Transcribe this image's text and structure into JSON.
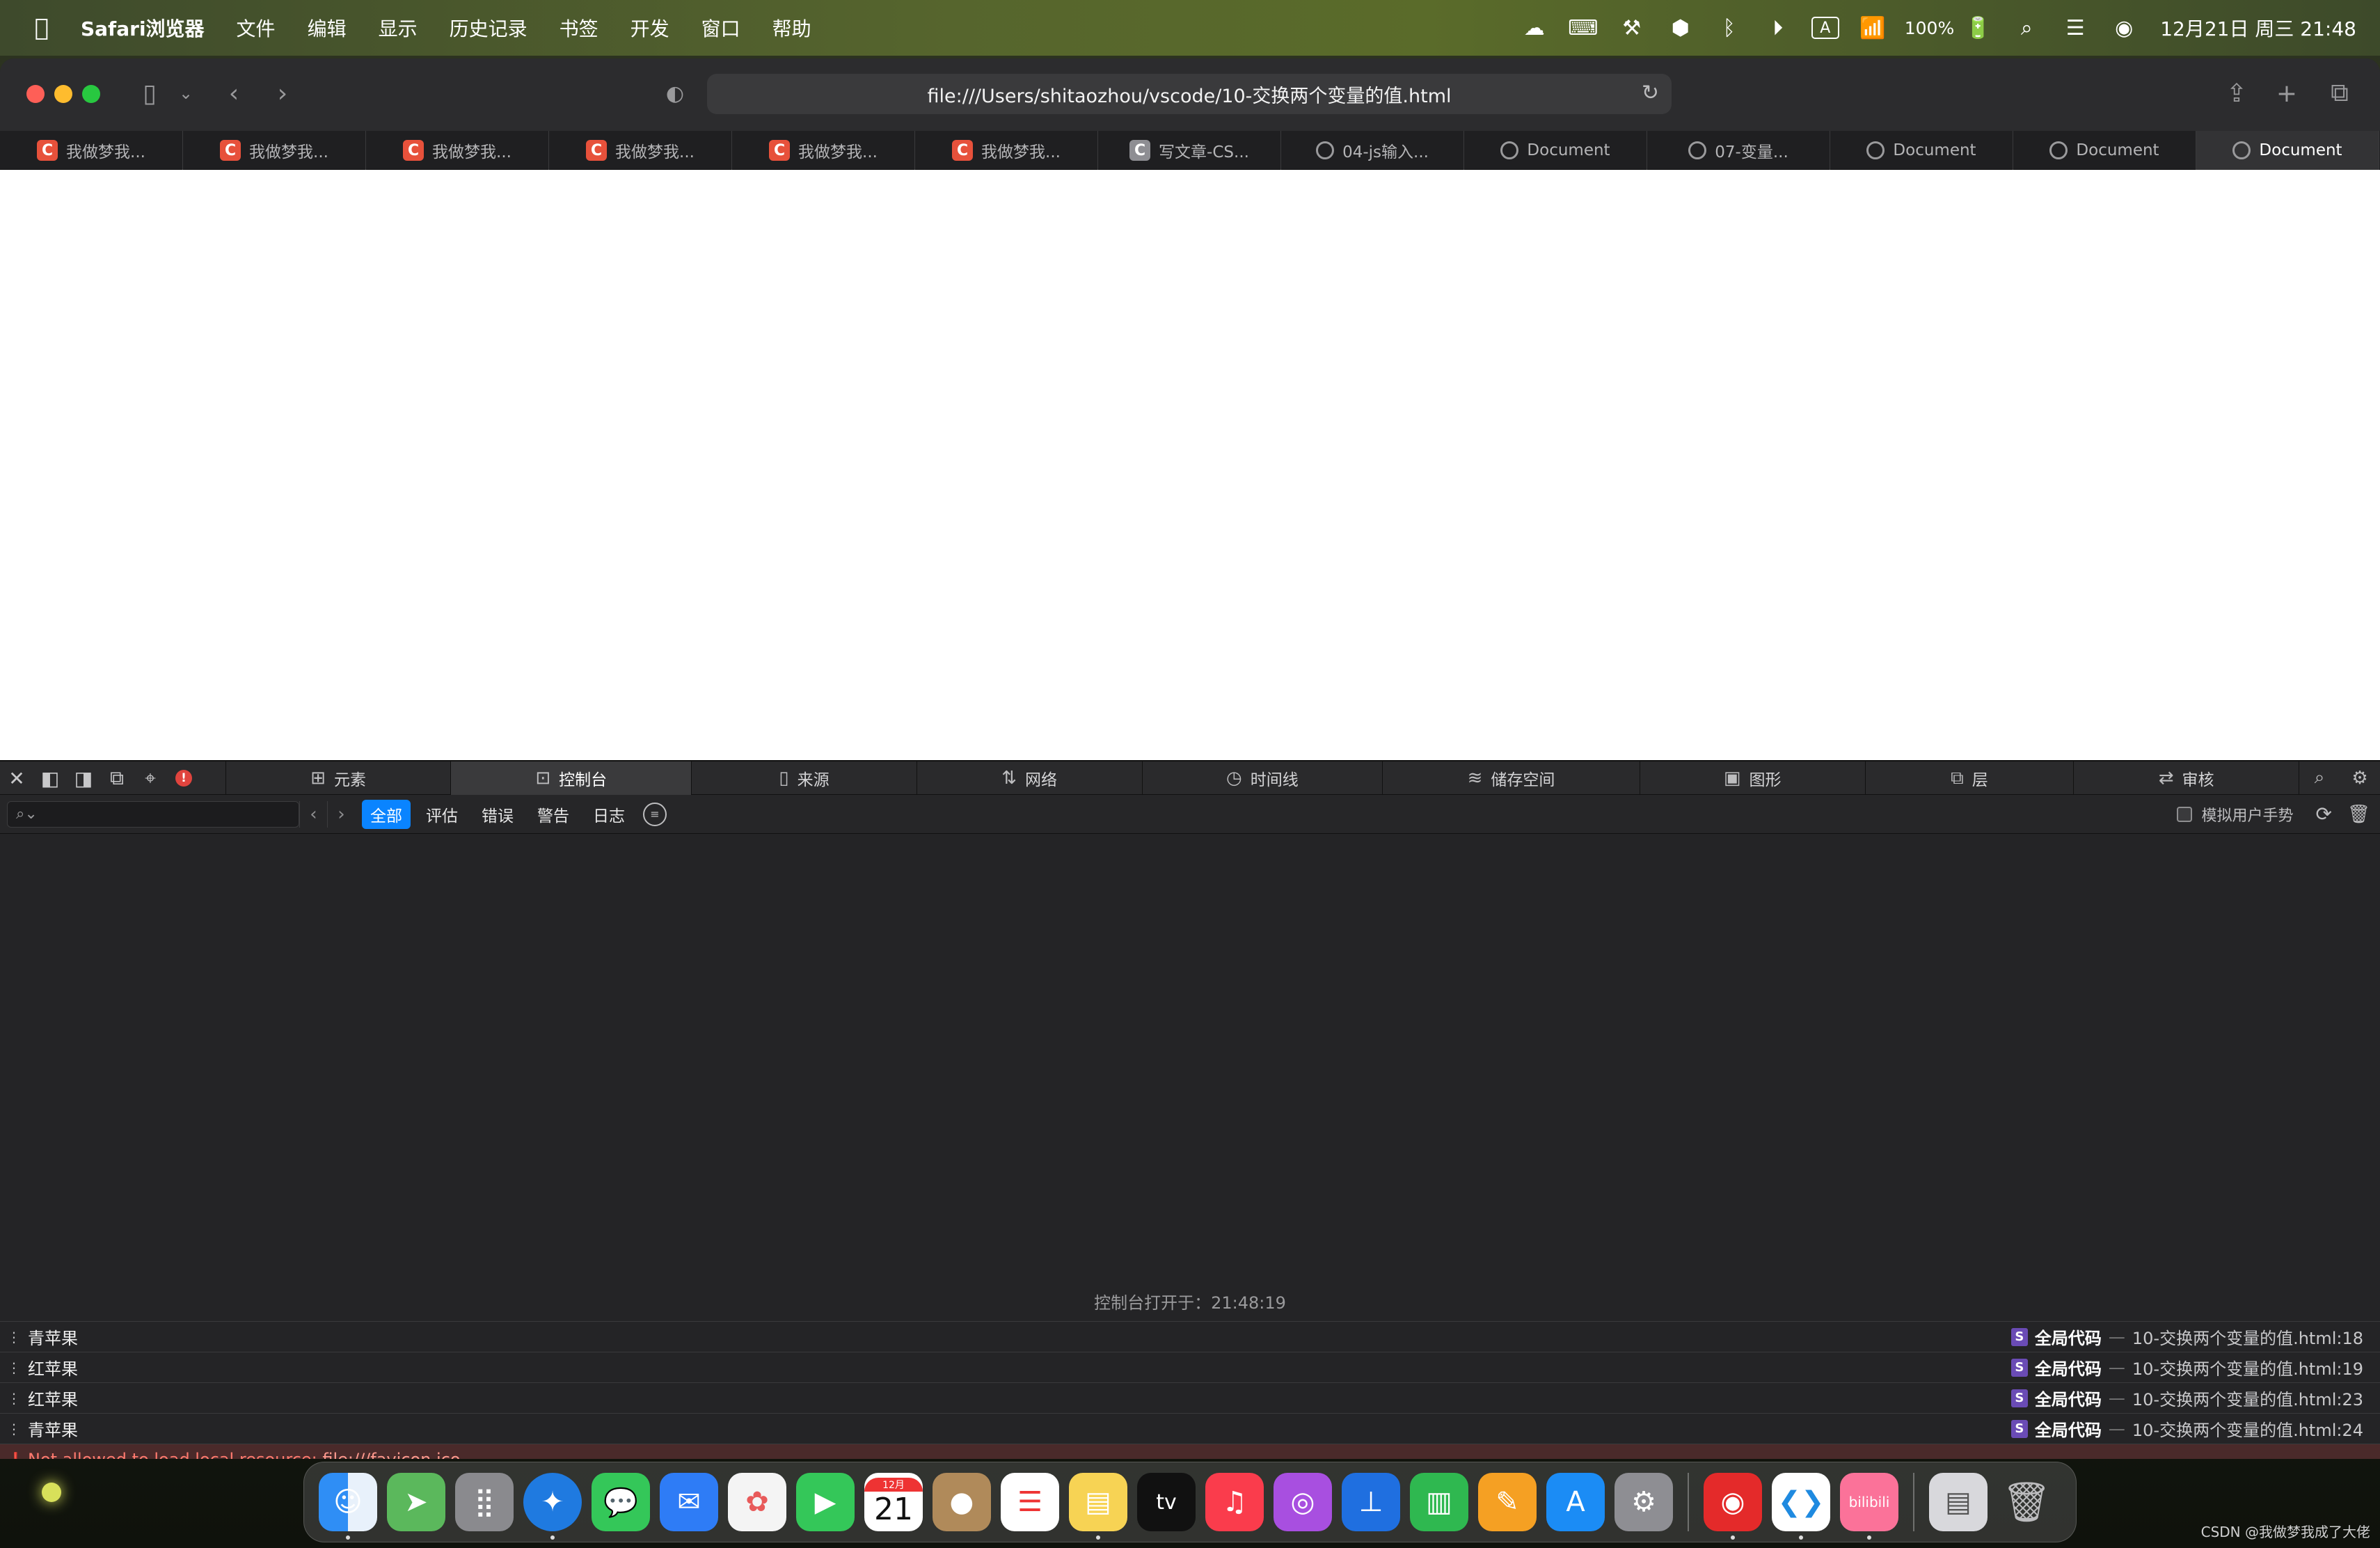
{
  "menubar": {
    "app_name": "Safari浏览器",
    "items": [
      "文件",
      "编辑",
      "显示",
      "历史记录",
      "书签",
      "开发",
      "窗口",
      "帮助"
    ],
    "battery": "100%",
    "clock": "12月21日 周三 21:48"
  },
  "browser": {
    "url": "file:///Users/shitaozhou/vscode/10-交换两个变量的值.html",
    "tabs": [
      {
        "label": "我做梦我...",
        "icon": "csdn-c",
        "active": false
      },
      {
        "label": "我做梦我...",
        "icon": "csdn-c",
        "active": false
      },
      {
        "label": "我做梦我...",
        "icon": "csdn-c",
        "active": false
      },
      {
        "label": "我做梦我...",
        "icon": "csdn-c",
        "active": false
      },
      {
        "label": "我做梦我...",
        "icon": "csdn-c",
        "active": false
      },
      {
        "label": "我做梦我...",
        "icon": "csdn-c",
        "active": false
      },
      {
        "label": "写文章-CS...",
        "icon": "csdn-c-gray",
        "active": false
      },
      {
        "label": "04-js输入...",
        "icon": "compass",
        "active": false
      },
      {
        "label": "Document",
        "icon": "compass",
        "active": false
      },
      {
        "label": "07-变量...",
        "icon": "compass",
        "active": false
      },
      {
        "label": "Document",
        "icon": "compass",
        "active": false
      },
      {
        "label": "Document",
        "icon": "compass",
        "active": false
      },
      {
        "label": "Document",
        "icon": "compass",
        "active": true
      }
    ]
  },
  "devtools": {
    "tabs": [
      {
        "label": "元素",
        "icon": "elements-icon",
        "active": false
      },
      {
        "label": "控制台",
        "icon": "console-icon",
        "active": true
      },
      {
        "label": "来源",
        "icon": "sources-icon",
        "active": false
      },
      {
        "label": "网络",
        "icon": "network-icon",
        "active": false
      },
      {
        "label": "时间线",
        "icon": "timeline-icon",
        "active": false
      },
      {
        "label": "储存空间",
        "icon": "storage-icon",
        "active": false
      },
      {
        "label": "图形",
        "icon": "graphics-icon",
        "active": false
      },
      {
        "label": "层",
        "icon": "layers-icon",
        "active": false
      },
      {
        "label": "审核",
        "icon": "audit-icon",
        "active": false
      }
    ],
    "filters": [
      {
        "label": "全部",
        "active": true
      },
      {
        "label": "评估",
        "active": false
      },
      {
        "label": "错误",
        "active": false
      },
      {
        "label": "警告",
        "active": false
      },
      {
        "label": "日志",
        "active": false
      }
    ],
    "simulate_gesture_label": "模拟用户手势",
    "opened_at": "控制台打开于：21:48:19",
    "logs": [
      {
        "message": "青苹果",
        "scope": "全局代码",
        "file": "10-交换两个变量的值.html:18"
      },
      {
        "message": "红苹果",
        "scope": "全局代码",
        "file": "10-交换两个变量的值.html:19"
      },
      {
        "message": "红苹果",
        "scope": "全局代码",
        "file": "10-交换两个变量的值.html:23"
      },
      {
        "message": "青苹果",
        "scope": "全局代码",
        "file": "10-交换两个变量的值.html:24"
      }
    ],
    "error": {
      "message": "Not allowed to load local resource: ",
      "link": "file:///favicon.ico"
    }
  },
  "dock": {
    "apps": [
      {
        "name": "finder",
        "color": "#2f8ef5",
        "running": true
      },
      {
        "name": "maps",
        "color": "#5bb85c",
        "running": false
      },
      {
        "name": "launchpad",
        "color": "#8a8a8e",
        "running": false
      },
      {
        "name": "safari",
        "color": "#1f7ae0",
        "running": true
      },
      {
        "name": "messages",
        "color": "#34c759",
        "running": false
      },
      {
        "name": "mail",
        "color": "#2e7cf6",
        "running": false
      },
      {
        "name": "photos",
        "color": "#f4f4f4",
        "running": false
      },
      {
        "name": "facetime",
        "color": "#34c759",
        "running": false
      },
      {
        "name": "calendar",
        "color": "#ffffff",
        "running": false
      },
      {
        "name": "contacts",
        "color": "#b08a5a",
        "running": false
      },
      {
        "name": "reminders",
        "color": "#ffffff",
        "running": false
      },
      {
        "name": "notes",
        "color": "#f7d354",
        "running": true
      },
      {
        "name": "tv",
        "color": "#111111",
        "running": false
      },
      {
        "name": "music",
        "color": "#fa3c4c",
        "running": false
      },
      {
        "name": "podcasts",
        "color": "#a84fe0",
        "running": false
      },
      {
        "name": "keynote",
        "color": "#1f6fe0",
        "running": false
      },
      {
        "name": "numbers",
        "color": "#2fb850",
        "running": false
      },
      {
        "name": "pages",
        "color": "#f5a023",
        "running": false
      },
      {
        "name": "app-store",
        "color": "#1b8cf5",
        "running": false
      },
      {
        "name": "system-settings",
        "color": "#8e8e93",
        "running": false
      },
      {
        "name": "netease-music",
        "color": "#e42a2a",
        "running": true
      },
      {
        "name": "vscode",
        "color": "#1f8ae0",
        "running": true
      },
      {
        "name": "bilibili",
        "color": "#fb7299",
        "running": true
      },
      {
        "name": "preview",
        "color": "#d8d8dc",
        "running": false
      },
      {
        "name": "trash",
        "color": "#9a9a9e",
        "running": false
      }
    ],
    "calendar_month": "12月",
    "calendar_day": "21",
    "tv_label": "tv",
    "bilibili_label": "bilibili"
  },
  "watermark": "CSDN @我做梦我成了大佬"
}
